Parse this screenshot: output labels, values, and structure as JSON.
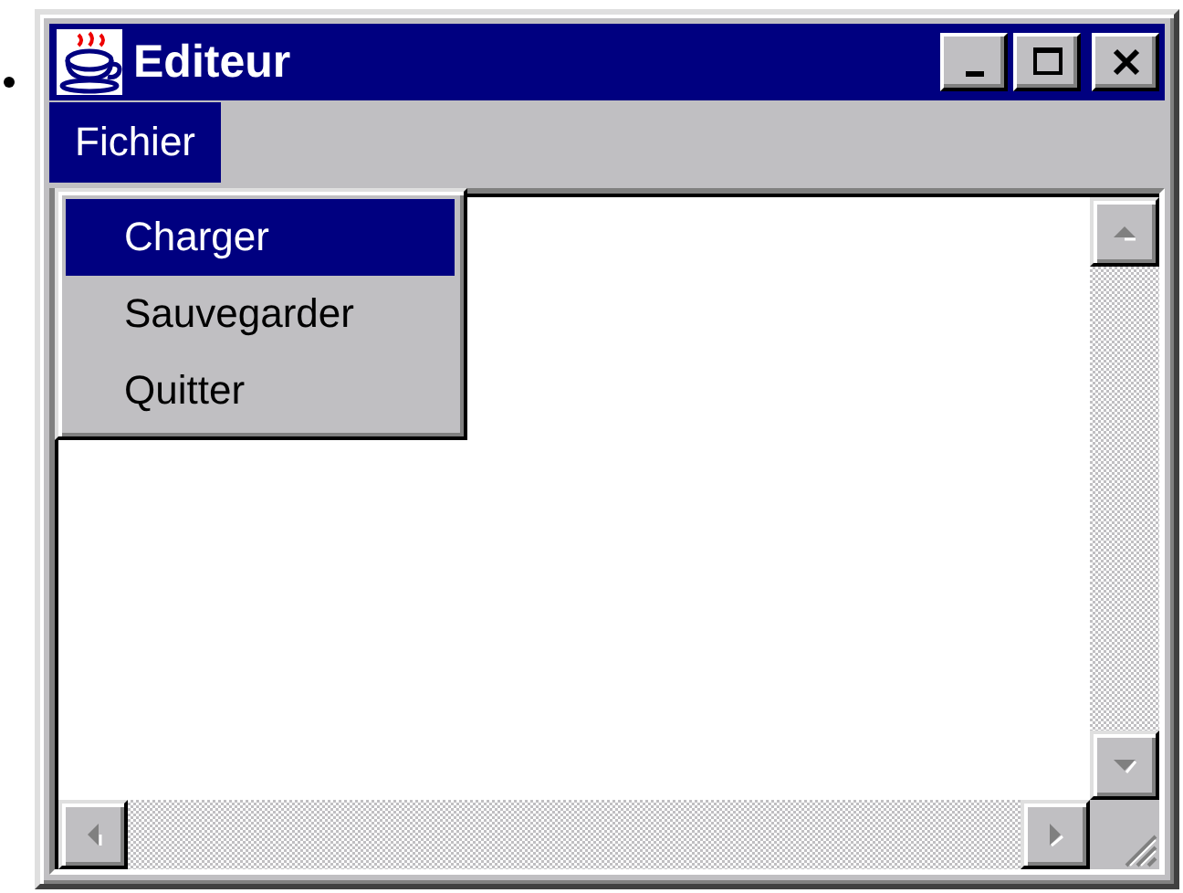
{
  "window": {
    "title": "Editeur"
  },
  "menu_bar": [
    {
      "label": "Fichier",
      "selected": true
    }
  ],
  "open_menu": {
    "items": [
      {
        "label": "Charger",
        "selected": true
      },
      {
        "label": "Sauvegarder",
        "selected": false
      },
      {
        "label": "Quitter",
        "selected": false
      }
    ]
  }
}
